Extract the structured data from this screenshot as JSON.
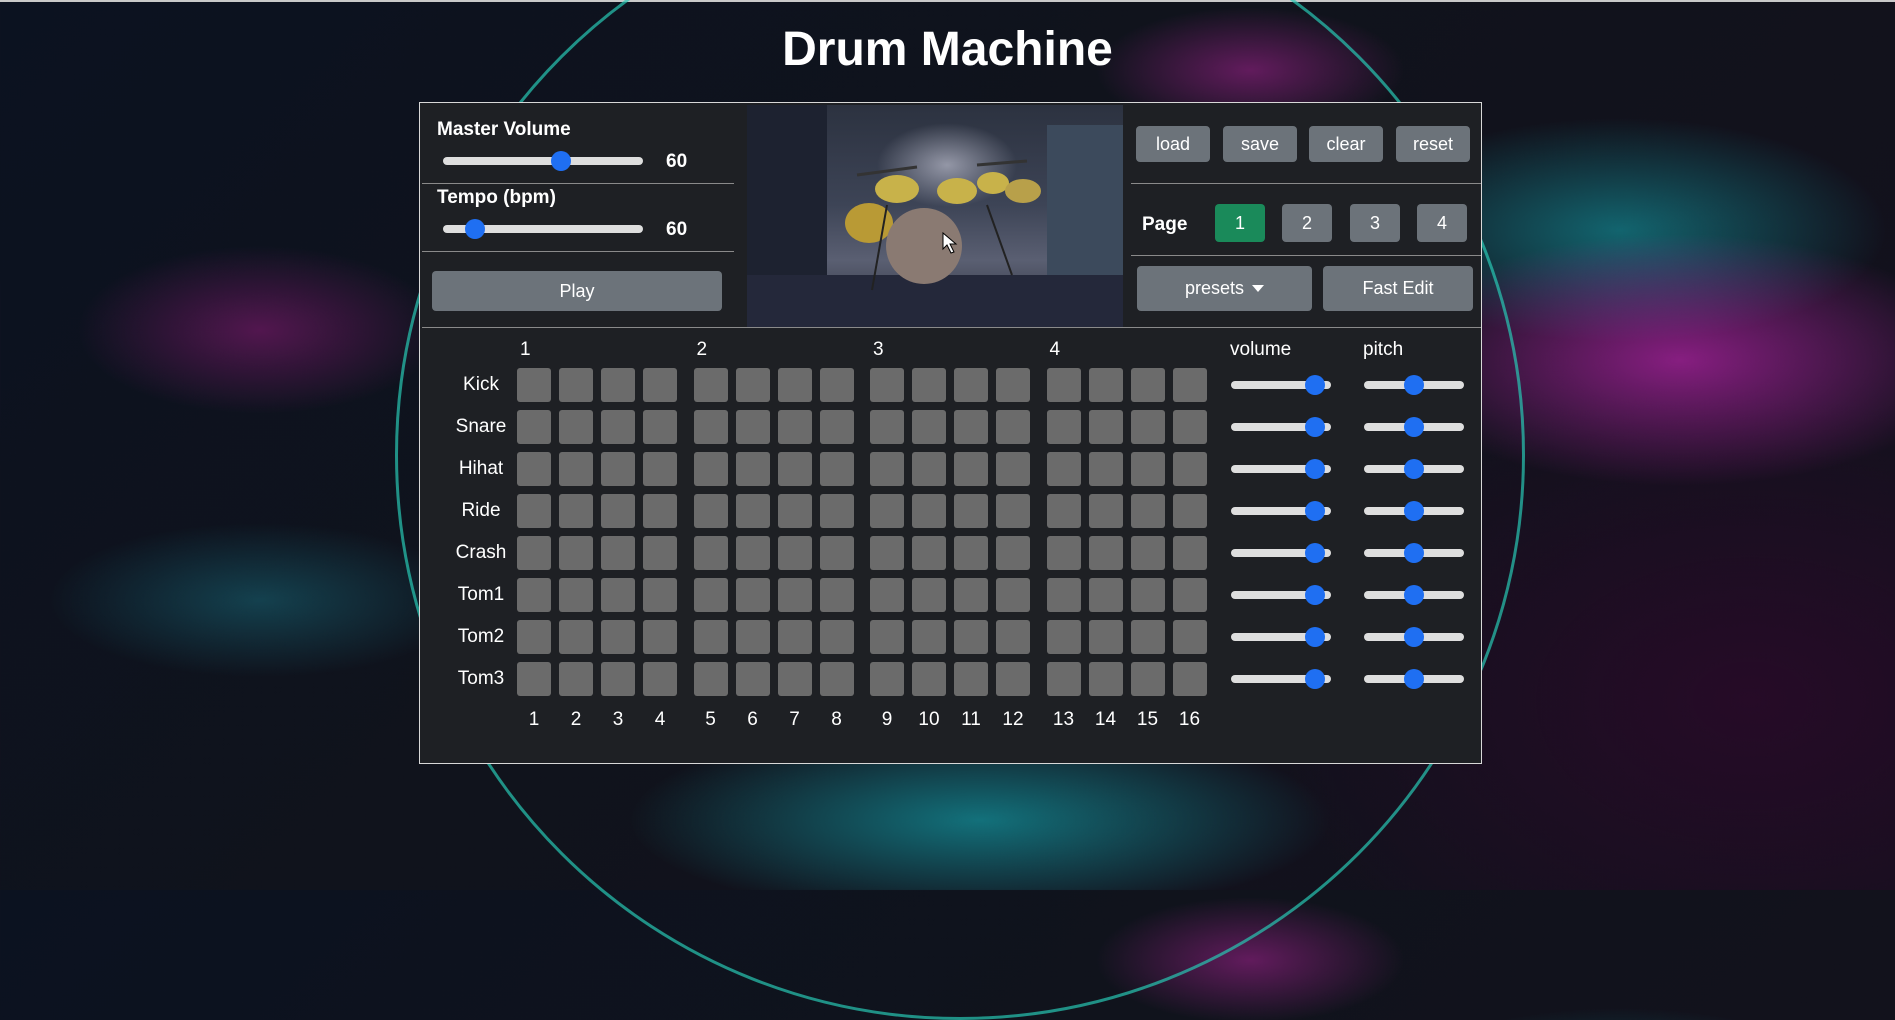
{
  "title": "Drum Machine",
  "master_volume": {
    "label": "Master Volume",
    "value": "60",
    "level": 0.6
  },
  "tempo": {
    "label": "Tempo (bpm)",
    "value": "60",
    "level": 0.12
  },
  "play_label": "Play",
  "actions": {
    "load": "load",
    "save": "save",
    "clear": "clear",
    "reset": "reset"
  },
  "page": {
    "label": "Page",
    "buttons": [
      "1",
      "2",
      "3",
      "4"
    ],
    "active": "1"
  },
  "presets_label": "presets",
  "fast_edit_label": "Fast Edit",
  "beat_headers": [
    "1",
    "2",
    "3",
    "4"
  ],
  "column_headers": {
    "volume": "volume",
    "pitch": "pitch"
  },
  "step_numbers": [
    "1",
    "2",
    "3",
    "4",
    "5",
    "6",
    "7",
    "8",
    "9",
    "10",
    "11",
    "12",
    "13",
    "14",
    "15",
    "16"
  ],
  "tracks": [
    {
      "name": "Kick",
      "volume": 0.92,
      "pitch": 0.5
    },
    {
      "name": "Snare",
      "volume": 0.92,
      "pitch": 0.5
    },
    {
      "name": "Hihat",
      "volume": 0.92,
      "pitch": 0.5
    },
    {
      "name": "Ride",
      "volume": 0.92,
      "pitch": 0.5
    },
    {
      "name": "Crash",
      "volume": 0.92,
      "pitch": 0.5
    },
    {
      "name": "Tom1",
      "volume": 0.92,
      "pitch": 0.5
    },
    {
      "name": "Tom2",
      "volume": 0.92,
      "pitch": 0.5
    },
    {
      "name": "Tom3",
      "volume": 0.92,
      "pitch": 0.5
    }
  ],
  "colors": {
    "accent": "#1f6ff2",
    "active_page": "#1a8a5a",
    "pad": "#6b6b6b",
    "button": "#6c737a"
  }
}
